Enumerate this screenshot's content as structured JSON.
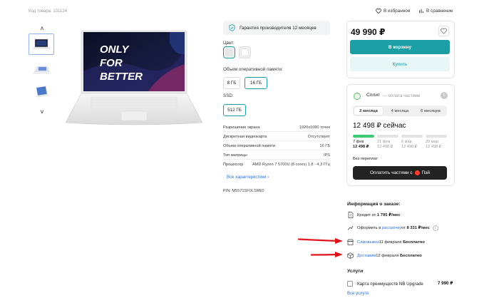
{
  "top": {
    "product_code": "Код товара: 131124",
    "favorites": "В избранное",
    "compare": "В сравнение"
  },
  "hero_image": {
    "slogan_line1": "ONLY",
    "slogan_line2": "FOR",
    "slogan_line3": "BETTER"
  },
  "options": {
    "warranty": "Гарантия производителя 12 месяцев",
    "color_label": "Цвет:",
    "ram_label": "Объем оперативной памяти:",
    "ram_values": [
      "8 ГБ",
      "16 ГБ"
    ],
    "ssd_label": "SSD:",
    "ssd_values": [
      "512 ГБ"
    ]
  },
  "specs": [
    {
      "name": "Разрешение экрана",
      "value": "1920x1080 точек"
    },
    {
      "name": "Дискретная видеокарта",
      "value": "Отсутствует"
    },
    {
      "name": "Объем оперативной памяти",
      "value": "16 ГБ"
    },
    {
      "name": "Тип матрицы",
      "value": "IPS"
    },
    {
      "name": "Процессор",
      "value": "AMD Ryzen 7 5700U (8 cores) 1,8 - 4,3 ГГц"
    }
  ],
  "all_specs_link": "Все характеристики ›",
  "part_number": "P/N: M5571SF0LSRE0",
  "buy": {
    "price": "49 990 ₽",
    "cart_button": "В корзину",
    "buy_button": "Купить"
  },
  "split": {
    "title": "Сплит",
    "subtitle": "— оплата частями",
    "info": "i",
    "tabs": [
      "2 месяца",
      "4 месяца",
      "6 месяцев"
    ],
    "pay_now": "12 498 ₽ сейчас",
    "schedule": [
      {
        "date": "7 фев",
        "amount": "12 498 ₽"
      },
      {
        "date": "21 фев",
        "amount": "12 498 ₽"
      },
      {
        "date": "6 мар",
        "amount": "12 498 ₽"
      },
      {
        "date": "20 мар",
        "amount": "12 498 ₽"
      }
    ],
    "no_overpay": "Без переплат",
    "button": "Оплатить частями с",
    "button_logo": "Пэй"
  },
  "order": {
    "title": "Информация о заказе:",
    "credit_pre": "Кредит от ",
    "credit_val": "1 795 ₽/мес",
    "install_pre": "Оформить в ",
    "install_link": "рассрочку",
    "install_mid": " от ",
    "install_val": "8 331 ₽/мес",
    "pickup_link": "Самовывоз",
    "pickup_date": " 11 февраля ",
    "pickup_free": "Бесплатно",
    "delivery_link": "Доставим",
    "delivery_date": " 12 февраля ",
    "delivery_free": "Бесплатно"
  },
  "services": {
    "title": "Услуги",
    "item": "Карта преимуществ NB Upgrade",
    "item_price": "7 990 ₽",
    "all_link": "Все услуги"
  },
  "colors": {
    "accent": "#1b9fa5",
    "arrow_red": "#e0141d",
    "split_green": "#3ccb74",
    "link_blue": "#2f6fd6"
  }
}
